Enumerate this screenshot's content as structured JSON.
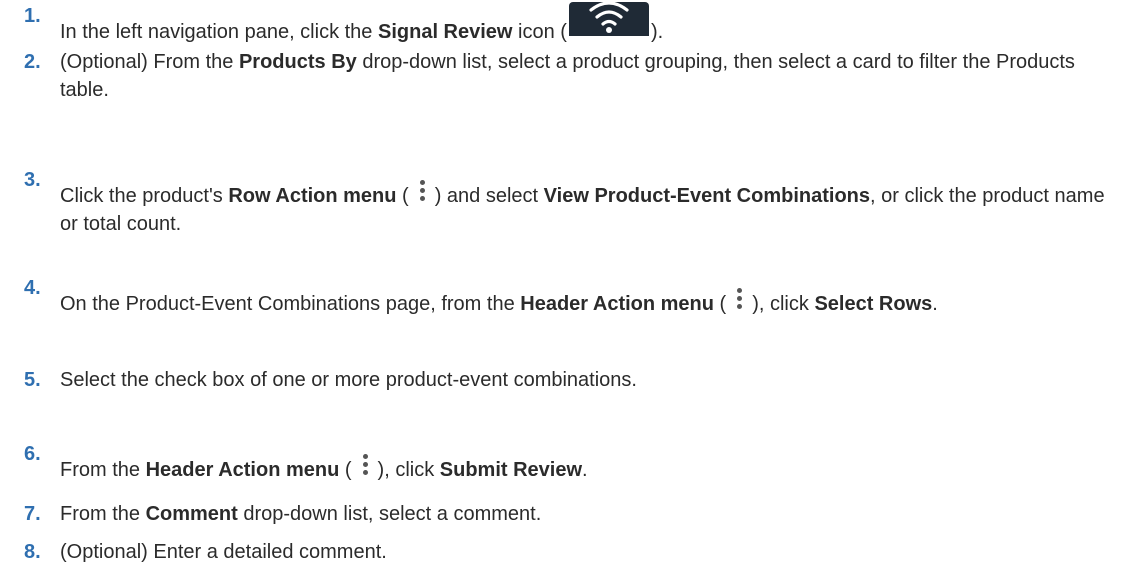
{
  "steps": [
    {
      "number": "1.",
      "pre": "In the left navigation pane, click the ",
      "bold1": "Signal Review",
      "mid": " icon (",
      "icon": "wifi-signal-icon",
      "post": ")."
    },
    {
      "number": "2.",
      "pre": "(Optional) From the ",
      "bold1": "Products By",
      "post": " drop-down list, select a product grouping, then select a card to filter the Products table."
    },
    {
      "number": "3.",
      "pre": "Click the product's ",
      "bold1": "Row Action menu",
      "mid": " (",
      "icon": "kebab-menu-icon",
      "mid2": ") and select ",
      "bold2": "View Product-Event Combinations",
      "post": ", or click the product name or total count."
    },
    {
      "number": "4.",
      "pre": "On the Product-Event Combinations page, from the ",
      "bold1": "Header Action menu",
      "mid": " (",
      "icon": "kebab-menu-icon",
      "mid2": "), click ",
      "bold2": "Select Rows",
      "post": "."
    },
    {
      "number": "5.",
      "pre": "Select the check box of one or more product-event combinations."
    },
    {
      "number": "6.",
      "pre": "From the ",
      "bold1": "Header Action menu",
      "mid": " (",
      "icon": "kebab-menu-icon",
      "mid2": "), click ",
      "bold2": "Submit Review",
      "post": "."
    },
    {
      "number": "7.",
      "pre": "From the ",
      "bold1": "Comment",
      "post": " drop-down list, select a comment."
    },
    {
      "number": "8.",
      "pre": "(Optional) Enter a detailed comment."
    }
  ],
  "colors": {
    "step_number": "#2f6fb0",
    "text": "#2b2b2b",
    "icon_bg": "#1f2a36"
  }
}
